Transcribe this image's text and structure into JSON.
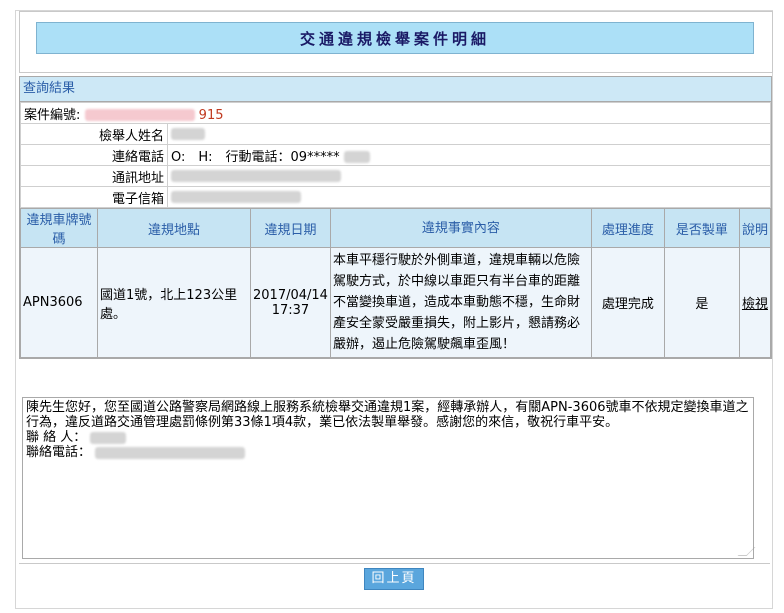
{
  "page": {
    "title": "交通違規檢舉案件明細"
  },
  "section": {
    "query_result": "查詢結果"
  },
  "info": {
    "case_no_label": "案件編號:",
    "case_no_suffix": "915",
    "reporter_label": "檢舉人姓名",
    "phone_label": "連絡電話",
    "phone_value": "O:　H:　行動電話：09*****",
    "address_label": "通訊地址",
    "email_label": "電子信箱"
  },
  "cases": {
    "headers": [
      "違規車牌號碼",
      "違規地點",
      "違規日期",
      "違規事實內容",
      "處理進度",
      "是否製單",
      "說明"
    ],
    "row": {
      "plate": "APN3606",
      "location": "國道1號，北上123公里處。",
      "date": "2017/04/14",
      "time": "17:37",
      "content": "本車平穩行駛於外側車道，違規車輛以危險駕駛方式，於中線以車距只有半台車的距離不當變換車道，造成本車動態不穩，生命財產安全蒙受嚴重損失，附上影片，懇請務必嚴辦，遏止危險駕駛飆車歪風！",
      "status": "處理完成",
      "ticketed": "是",
      "view_link": "檢視"
    }
  },
  "reply": {
    "text": "陳先生您好，您至國道公路警察局網路線上服務系統檢舉交通違規1案，經轉承辦人，有關APN-3606號車不依規定變換車道之行為，違反道路交通管理處罰條例第33條1項4款，業已依法製單舉發。感謝您的來信，敬祝行車平安。",
    "contact_label": "聯 絡 人：",
    "contact_phone_label": "聯絡電話："
  },
  "buttons": {
    "back": "回上頁"
  }
}
